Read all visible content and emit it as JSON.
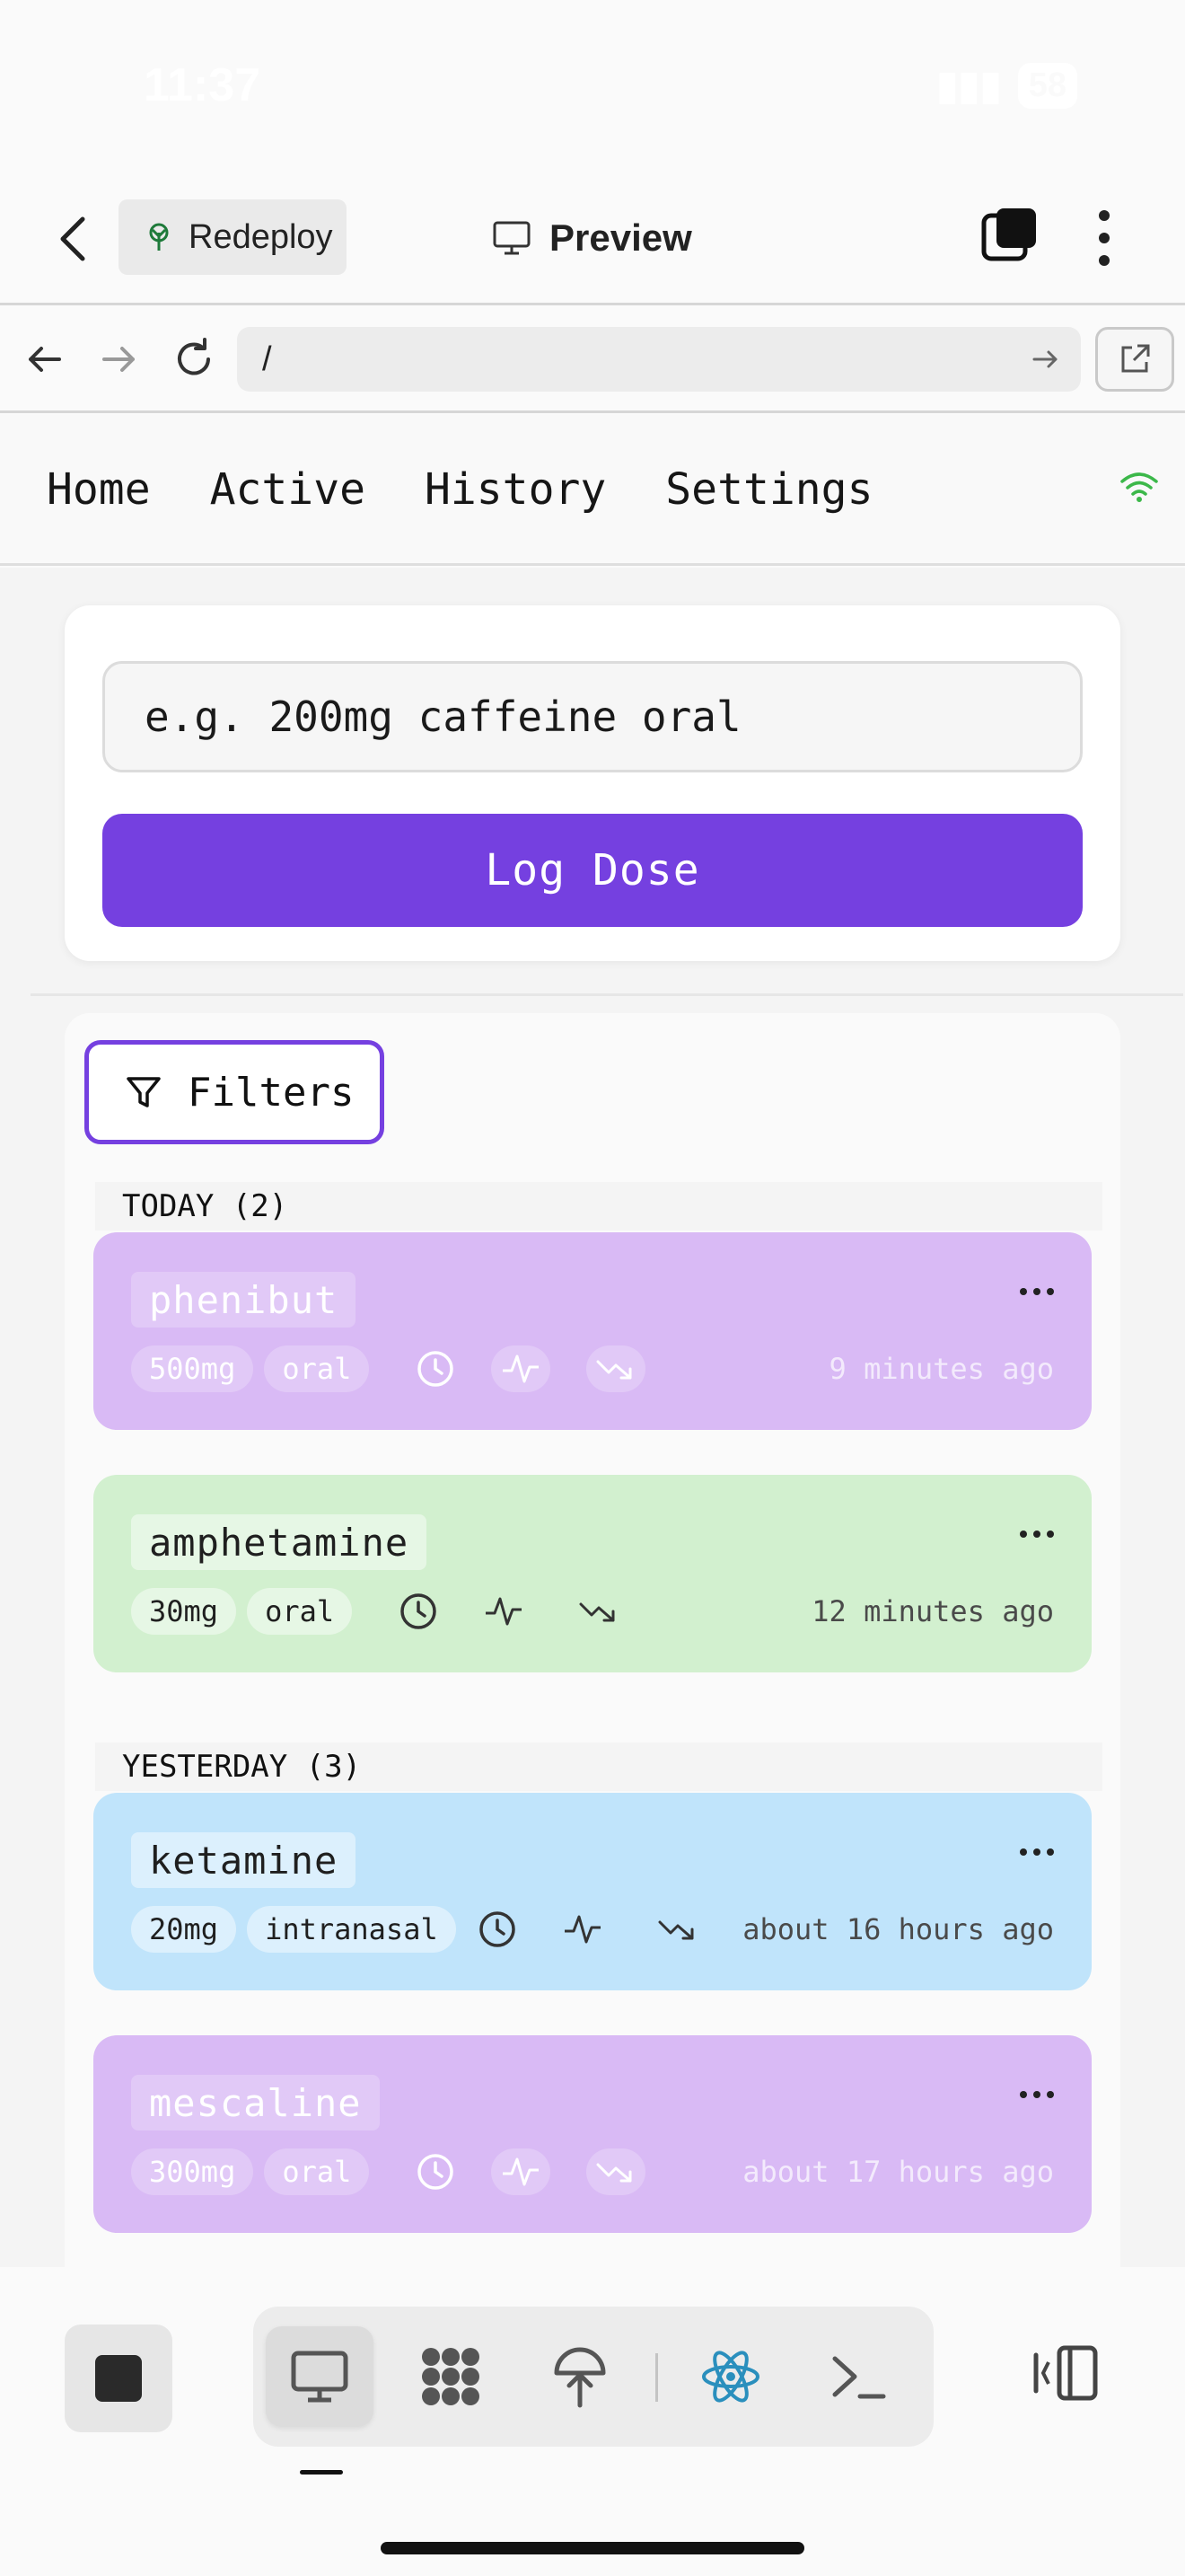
{
  "status_bar": {
    "time": "11:37",
    "battery": "58"
  },
  "header": {
    "redeploy_label": "Redeploy",
    "preview_label": "Preview"
  },
  "url_bar": {
    "url": "/"
  },
  "app_nav": {
    "items": [
      "Home",
      "Active",
      "History",
      "Settings"
    ],
    "connection_status": "wifi-icon"
  },
  "dose_form": {
    "placeholder": "e.g. 200mg caffeine oral",
    "submit_label": "Log Dose"
  },
  "filters_label": "Filters",
  "groups": [
    {
      "heading": "TODAY (2)",
      "entries": [
        {
          "name": "phenibut",
          "amount": "500mg",
          "route": "oral",
          "time_ago": "9 minutes ago",
          "color": "#d9baf5"
        },
        {
          "name": "amphetamine",
          "amount": "30mg",
          "route": "oral",
          "time_ago": "12 minutes ago",
          "color": "#d2f0cf"
        }
      ]
    },
    {
      "heading": "YESTERDAY (3)",
      "entries": [
        {
          "name": "ketamine",
          "amount": "20mg",
          "route": "intranasal",
          "time_ago": "about 16 hours ago",
          "color": "#c0e4fb"
        },
        {
          "name": "mescaline",
          "amount": "300mg",
          "route": "oral",
          "time_ago": "about 17 hours ago",
          "color": "#d9baf5"
        }
      ]
    }
  ],
  "accent_color": "#7540e0",
  "bottom_toolbar": {
    "tools": [
      "preview-icon",
      "workflows-icon",
      "deploy-icon",
      "react-icon",
      "console-icon"
    ],
    "active_tool": "preview-icon"
  }
}
